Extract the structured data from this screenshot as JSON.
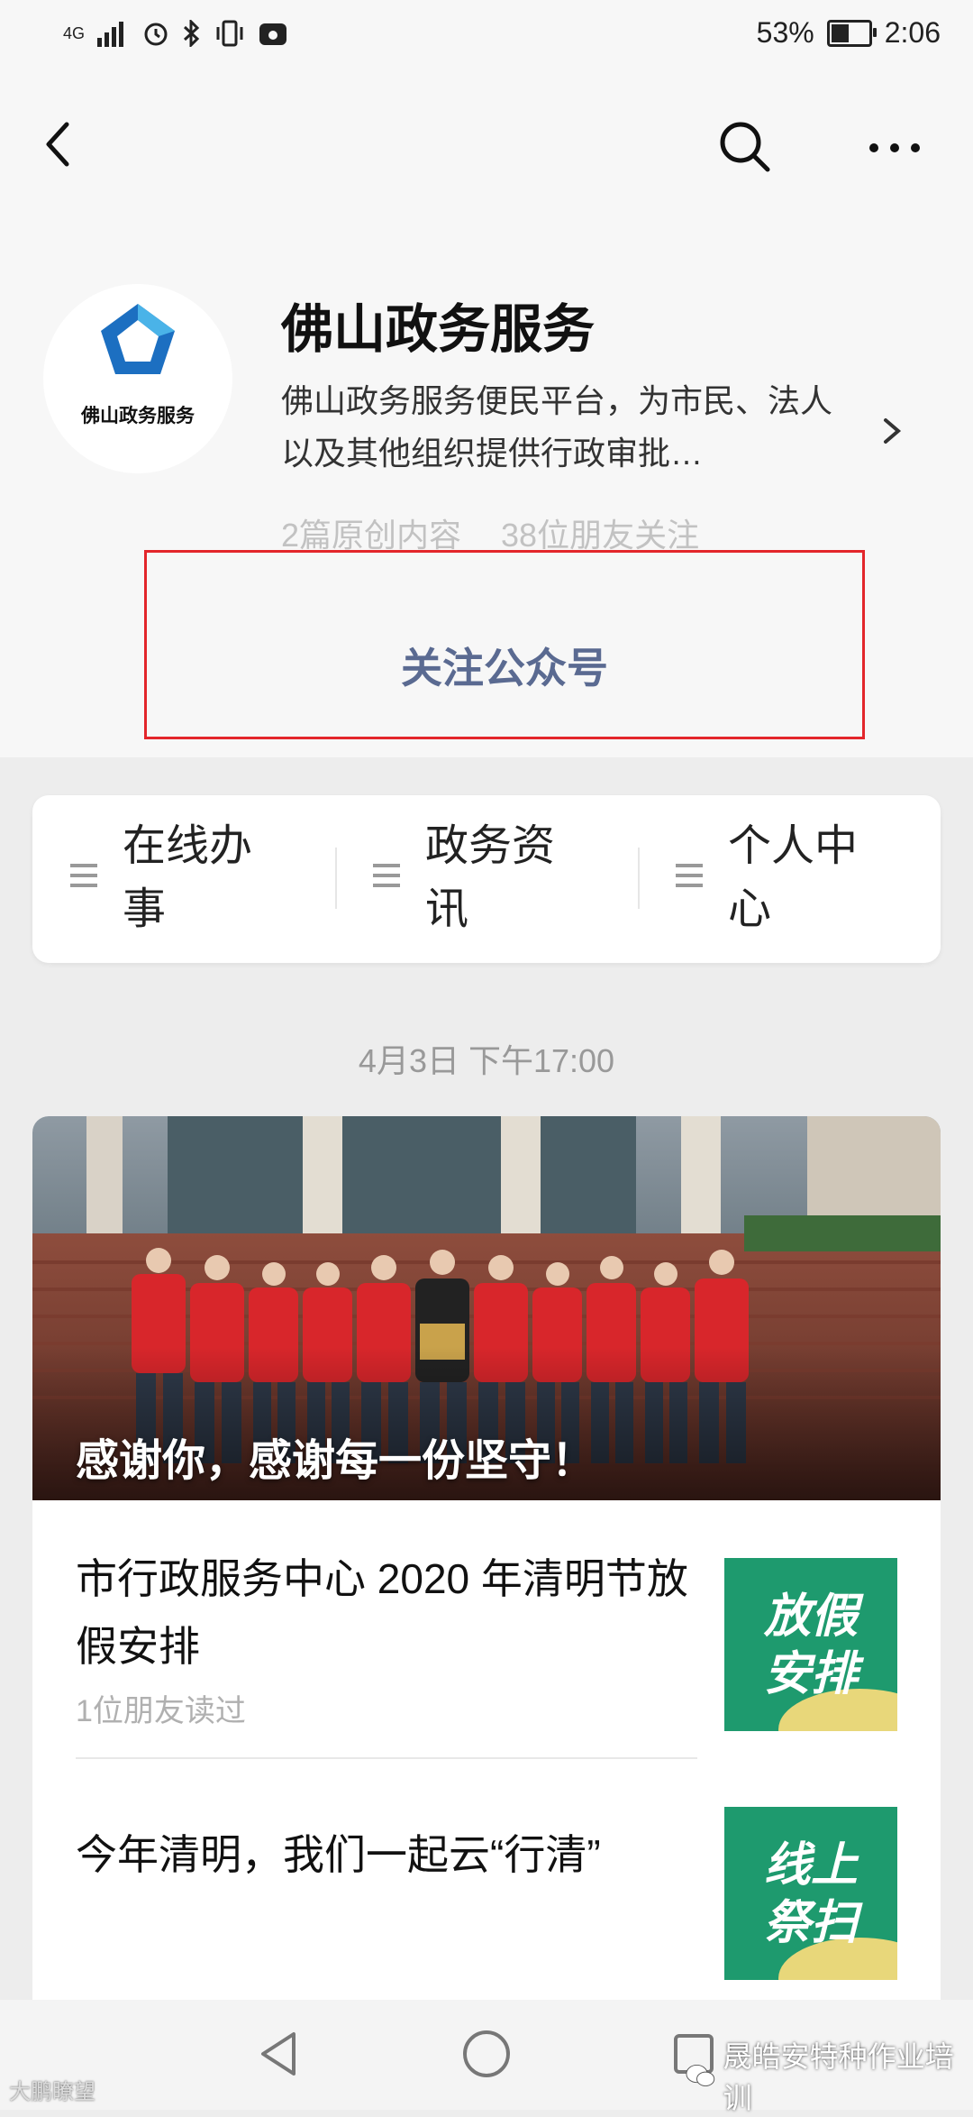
{
  "status_bar": {
    "network": "4G",
    "battery": "53%",
    "battery_level": 0.53,
    "time": "2:06"
  },
  "account": {
    "logo_text": "佛山政务服务",
    "name": "佛山政务服务",
    "description": "佛山政务服务便民平台，为市民、法人以及其他组织提供行政审批…",
    "original_count": "2篇原创内容",
    "friends_following": "38位朋友关注",
    "follow_button": "关注公众号"
  },
  "menu": {
    "items": [
      {
        "label": "在线办事"
      },
      {
        "label": "政务资讯"
      },
      {
        "label": "个人中心"
      }
    ]
  },
  "feed": {
    "timestamp": "4月3日 下午17:00",
    "hero_caption": "感谢你，感谢每一份坚守！",
    "articles": [
      {
        "title": "市行政服务中心 2020 年清明节放假安排",
        "meta": "1位朋友读过",
        "thumb_text": [
          "放假",
          "安排"
        ]
      },
      {
        "title": "今年清明，我们一起云“行清”",
        "meta": "",
        "thumb_text": [
          "线上",
          "祭扫"
        ]
      }
    ]
  },
  "watermark": {
    "right": "晟皓安特种作业培训",
    "left": "大鹏瞭望"
  },
  "colors": {
    "follow_text": "#5a6a91",
    "highlight_border": "#e3262b",
    "thumb_green": "#1e9a6e",
    "logo_blue": "#1c6fc1"
  }
}
